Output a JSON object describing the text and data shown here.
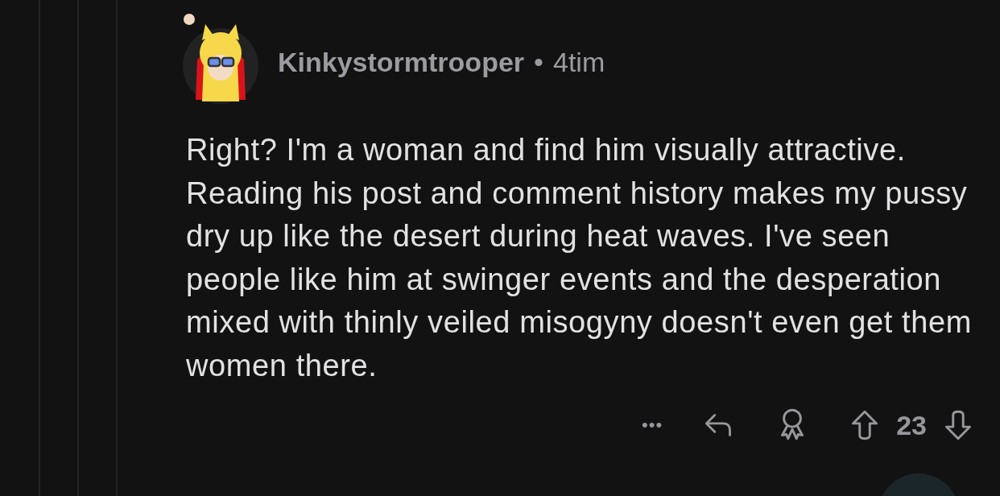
{
  "comment": {
    "author": "Kinkystormtrooper",
    "separator": "•",
    "time": "4tim",
    "body": "Right? I'm a woman and find him visually attractive. Reading his post and comment history makes my pussy dry up like the desert during heat waves. I've seen people like him at swinger events and the desperation mixed with thinly veiled misogyny doesn't even get them women there.",
    "actions": {
      "more": "•••",
      "score": "23"
    }
  }
}
